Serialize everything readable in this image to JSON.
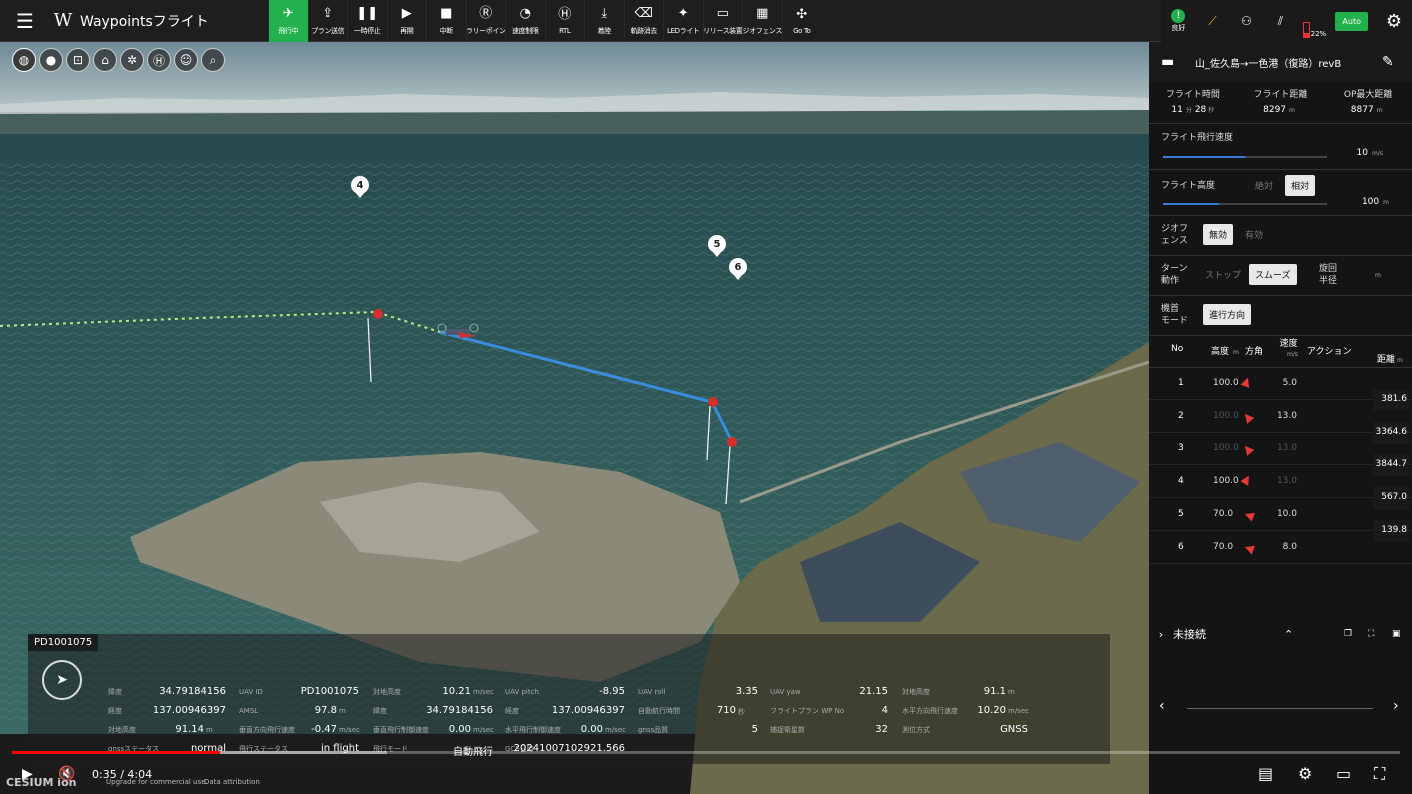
{
  "topbar": {
    "app_title": "Waypointsフライト",
    "logo": "W",
    "buttons": [
      {
        "label": "飛行中",
        "icon": "drone-icon",
        "glyph": "✈",
        "active": true
      },
      {
        "label": "プラン送信",
        "icon": "upload-icon",
        "glyph": "⇪"
      },
      {
        "label": "一時停止",
        "icon": "pause-icon",
        "glyph": "❚❚"
      },
      {
        "label": "再開",
        "icon": "play-icon",
        "glyph": "▶"
      },
      {
        "label": "中断",
        "icon": "stop-icon",
        "glyph": "■"
      },
      {
        "label": "ラリーポイン",
        "icon": "rally-point-icon",
        "glyph": "Ⓡ"
      },
      {
        "label": "速度制限",
        "icon": "speed-limit-icon",
        "glyph": "◔"
      },
      {
        "label": "RTL",
        "icon": "rtl-icon",
        "glyph": "Ⓗ"
      },
      {
        "label": "着陸",
        "icon": "land-icon",
        "glyph": "⤓"
      },
      {
        "label": "軌跡消去",
        "icon": "clear-track-icon",
        "glyph": "⌫"
      },
      {
        "label": "LEDライト",
        "icon": "led-light-icon",
        "glyph": "✦"
      },
      {
        "label": "リリース装置",
        "icon": "release-device-icon",
        "glyph": "▭"
      },
      {
        "label": "ジオフェンス",
        "icon": "geofence-icon",
        "glyph": "▦"
      },
      {
        "label": "Go To",
        "icon": "goto-icon",
        "glyph": "✣"
      }
    ],
    "status": {
      "health_label": "良好",
      "battery_percent": "22",
      "battery_unit": "%",
      "auto_label": "Auto"
    }
  },
  "map": {
    "waypoint_labels": [
      "4",
      "5",
      "6"
    ]
  },
  "telemetry": {
    "uav_tag": "PD1001075",
    "rows": [
      [
        {
          "k": "緯度",
          "v": "34.79184156"
        },
        {
          "k": "UAV ID",
          "v": "PD1001075"
        },
        {
          "k": "対地高度",
          "v": "10.21",
          "u": "m/sec"
        },
        {
          "k": "UAV pitch",
          "v": "-8.95"
        },
        {
          "k": "UAV roll",
          "v": "3.35"
        },
        {
          "k": "UAV yaw",
          "v": "21.15"
        },
        {
          "k": "対地高度",
          "v": "91.1",
          "u": "m"
        }
      ],
      [
        {
          "k": "経度",
          "v": "137.00946397"
        },
        {
          "k": "AMSL",
          "v": "97.8",
          "u": "m"
        },
        {
          "k": "緯度",
          "v": "34.79184156"
        },
        {
          "k": "経度",
          "v": "137.00946397"
        },
        {
          "k": "自動航行時間",
          "v": "710",
          "u": "秒"
        },
        {
          "k": "フライトプラン WP No",
          "v": "4"
        },
        {
          "k": "水平方向飛行速度",
          "v": "10.20",
          "u": "m/sec"
        }
      ],
      [
        {
          "k": "対地高度",
          "v": "91.14",
          "u": "m"
        },
        {
          "k": "垂直方向飛行速度",
          "v": "-0.47",
          "u": "m/sec"
        },
        {
          "k": "垂直飛行制御速度",
          "v": "0.00",
          "u": "m/sec"
        },
        {
          "k": "水平飛行制御速度",
          "v": "0.00",
          "u": "m/sec"
        },
        {
          "k": "gnss品質",
          "v": "5"
        },
        {
          "k": "捕捉衛星数",
          "v": "32"
        },
        {
          "k": "測位方式",
          "v": "GNSS"
        }
      ],
      [
        {
          "k": "gnssステータス",
          "v": "normal"
        },
        {
          "k": "飛行ステータス",
          "v": "in flight"
        },
        {
          "k": "飛行モード",
          "v": "自動飛行"
        },
        {
          "k": "GCS日時",
          "v": "20241007102921.566"
        }
      ]
    ]
  },
  "player": {
    "time": "0:35 / 4:04",
    "played_fraction": 0.15,
    "buffered_fraction": 0.27,
    "cesium_logo": "CESIUM ion",
    "cesium_note": "Upgrade for commercial use.",
    "data_attribution": "Data attribution"
  },
  "panel": {
    "plan_name": "山_佐久島→一色港（復路）revB",
    "stats": [
      {
        "h": "フライト時間",
        "v": "11",
        "u1": "分",
        "v2": "28",
        "u2": "秒"
      },
      {
        "h": "フライト距離",
        "v": "8297",
        "u1": "m"
      },
      {
        "h": "OP最大距離",
        "v": "8877",
        "u1": "m"
      }
    ],
    "speed": {
      "label": "フライト飛行速度",
      "value": "10",
      "unit": "m/s",
      "fraction": 0.5
    },
    "altitude": {
      "label": "フライト高度",
      "opt_abs": "絶対",
      "opt_rel": "相対",
      "value": "100",
      "unit": "m",
      "fraction": 0.34
    },
    "geofence": {
      "label1": "ジオフ",
      "label2": "ェンス",
      "opt_off": "無効",
      "opt_on": "有効"
    },
    "turn": {
      "label1": "ターン",
      "label2": "動作",
      "opt_stop": "ストップ",
      "opt_smooth": "スムーズ",
      "radius_label1": "旋回",
      "radius_label2": "半径",
      "radius_unit": "m"
    },
    "heading": {
      "label1": "機首",
      "label2": "モード",
      "opt": "進行方向"
    },
    "table": {
      "headers": {
        "no": "No",
        "alt": "高度",
        "alt_unit": "m",
        "dir": "方角",
        "speed": "速度",
        "speed_unit": "m/s",
        "action": "アクション",
        "dist": "距離",
        "dist_unit": "m"
      },
      "rows": [
        {
          "no": "1",
          "alt": "100.0",
          "speed": "5.0",
          "rot": 20,
          "alt_dim": false,
          "speed_dim": false
        },
        {
          "no": "2",
          "alt": "100.0",
          "speed": "13.0",
          "rot": -40,
          "alt_dim": true,
          "speed_dim": false
        },
        {
          "no": "3",
          "alt": "100.0",
          "speed": "13.0",
          "rot": -40,
          "alt_dim": true,
          "speed_dim": true
        },
        {
          "no": "4",
          "alt": "100.0",
          "speed": "13.0",
          "rot": 30,
          "alt_dim": false,
          "speed_dim": true
        },
        {
          "no": "5",
          "alt": "70.0",
          "speed": "10.0",
          "rot": -70,
          "alt_dim": false,
          "speed_dim": false
        },
        {
          "no": "6",
          "alt": "70.0",
          "speed": "8.0",
          "rot": -70,
          "alt_dim": false,
          "speed_dim": false
        }
      ],
      "distances": [
        "381.6",
        "3364.6",
        "3844.7",
        "567.0",
        "139.8"
      ]
    },
    "connection": {
      "label": "未接続"
    }
  }
}
